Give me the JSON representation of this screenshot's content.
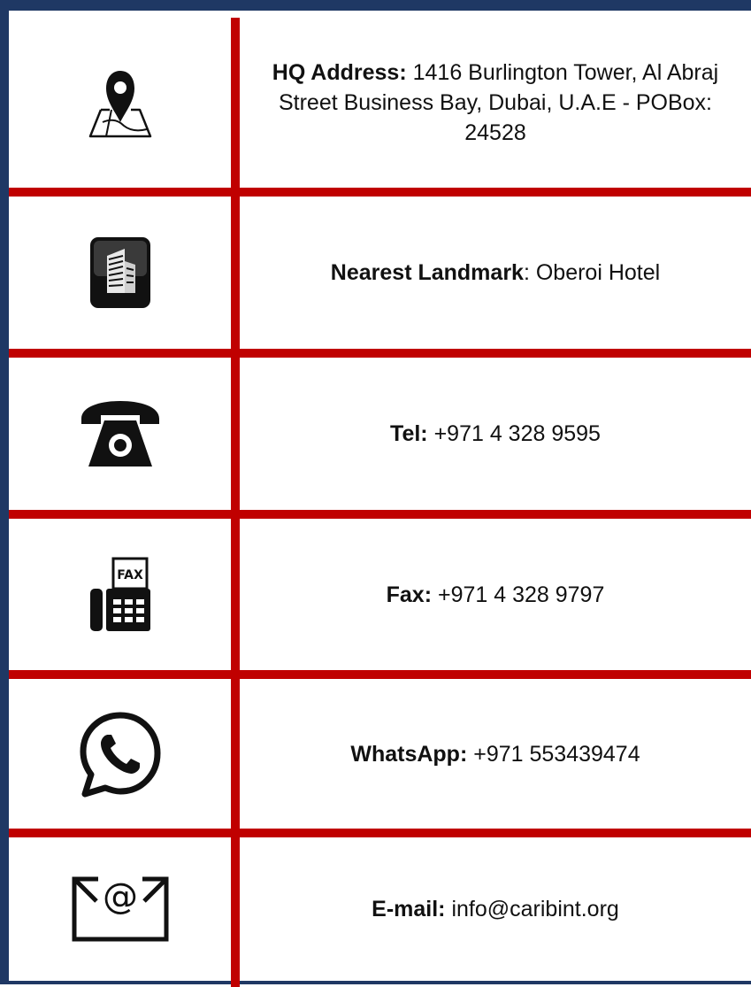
{
  "rows": [
    {
      "label": "HQ Address:",
      "value": " 1416 Burlington Tower, Al Abraj Street Business Bay, Dubai, U.A.E - POBox: 24528",
      "icon": "map-pin-icon"
    },
    {
      "label": "Nearest Landmark",
      "value": ": Oberoi Hotel",
      "icon": "building-icon"
    },
    {
      "label": "Tel:",
      "value": " +971 4 328 9595",
      "icon": "telephone-icon"
    },
    {
      "label": "Fax:",
      "value": " +971 4 328 9797",
      "icon": "fax-icon"
    },
    {
      "label": "WhatsApp:",
      "value": " +971 553439474",
      "icon": "whatsapp-icon"
    },
    {
      "label": "E-mail:",
      "value": " info@caribint.org",
      "icon": "email-icon"
    }
  ],
  "fax_icon_text": "FAX",
  "colors": {
    "frame": "#1f3864",
    "divider": "#c00000"
  }
}
